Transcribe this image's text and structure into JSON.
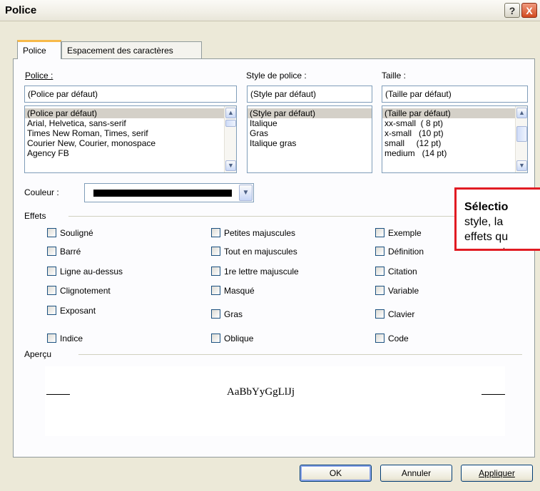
{
  "window": {
    "title": "Police",
    "help_label": "?",
    "close_label": "X"
  },
  "tabs": [
    {
      "label": "Police"
    },
    {
      "label": "Espacement des caractères"
    }
  ],
  "font": {
    "label": "Police :",
    "value": "(Police par défaut)",
    "items": [
      "(Police par défaut)",
      "Arial, Helvetica, sans-serif",
      "Times New Roman, Times, serif",
      "Courier New, Courier, monospace",
      "Agency FB"
    ]
  },
  "style": {
    "label": "Style de police :",
    "value": "(Style par défaut)",
    "items": [
      "(Style par défaut)",
      "Italique",
      "Gras",
      "Italique gras"
    ]
  },
  "size": {
    "label": "Taille :",
    "value": "(Taille par défaut)",
    "items": [
      "(Taille par défaut)",
      "xx-small  ( 8 pt)",
      "x-small   (10 pt)",
      "small     (12 pt)",
      "medium   (14 pt)"
    ]
  },
  "color": {
    "label": "Couleur :",
    "value_color": "#000000"
  },
  "effects": {
    "label": "Effets",
    "col1": [
      "Souligné",
      "Barré",
      "Ligne au-dessus",
      "Clignotement",
      "Exposant",
      "Indice"
    ],
    "col2": [
      "Petites majuscules",
      "Tout en majuscules",
      "1re lettre majuscule",
      "Masqué",
      "Gras",
      "Oblique"
    ],
    "col3": [
      "Exemple",
      "Définition",
      "Citation",
      "Variable",
      "Clavier",
      "Code"
    ]
  },
  "preview": {
    "label": "Aperçu",
    "sample": "AaBbYyGgLlJj"
  },
  "buttons": {
    "ok": "OK",
    "cancel": "Annuler",
    "apply": "Appliquer"
  },
  "callout": {
    "line1": "Sélectio",
    "line2": "style, la",
    "line3": "effets qu",
    "line4": "pour vot"
  }
}
